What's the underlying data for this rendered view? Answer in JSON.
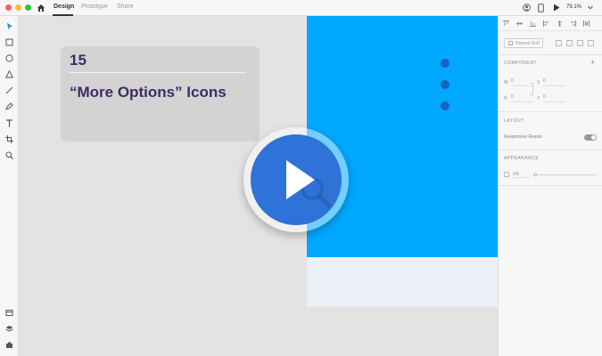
{
  "window": {
    "tabs": [
      {
        "label": "Design",
        "active": true
      },
      {
        "label": "Prototype",
        "active": false
      },
      {
        "label": "Share",
        "active": false
      }
    ],
    "zoom": "79.1%"
  },
  "left_toolbar": {
    "tools": [
      "select-icon",
      "rectangle-icon",
      "ellipse-icon",
      "triangle-icon",
      "line-icon",
      "pen-icon",
      "text-icon",
      "artboard-icon",
      "zoom-icon"
    ],
    "bottom": [
      "assets-icon",
      "layers-icon",
      "plugins-icon"
    ]
  },
  "canvas": {
    "card": {
      "number": "15",
      "title": "“More Options” Icons"
    },
    "colors": {
      "artboard": "#00a8ff",
      "dots": "#1565c0",
      "card_text": "#3e2b66",
      "play_button": "#2f72d8"
    }
  },
  "right_panel": {
    "repeat_grid": "Repeat Grid",
    "component_title": "COMPONENT",
    "fields": {
      "w_label": "W",
      "w_value": "0",
      "h_label": "H",
      "h_value": "0",
      "x_label": "X",
      "x_value": "0",
      "y_label": "Y",
      "y_value": "0"
    },
    "layout_title": "LAYOUT",
    "responsive_resize": "Responsive Resize",
    "appearance_title": "APPEARANCE",
    "opacity": "0%"
  }
}
